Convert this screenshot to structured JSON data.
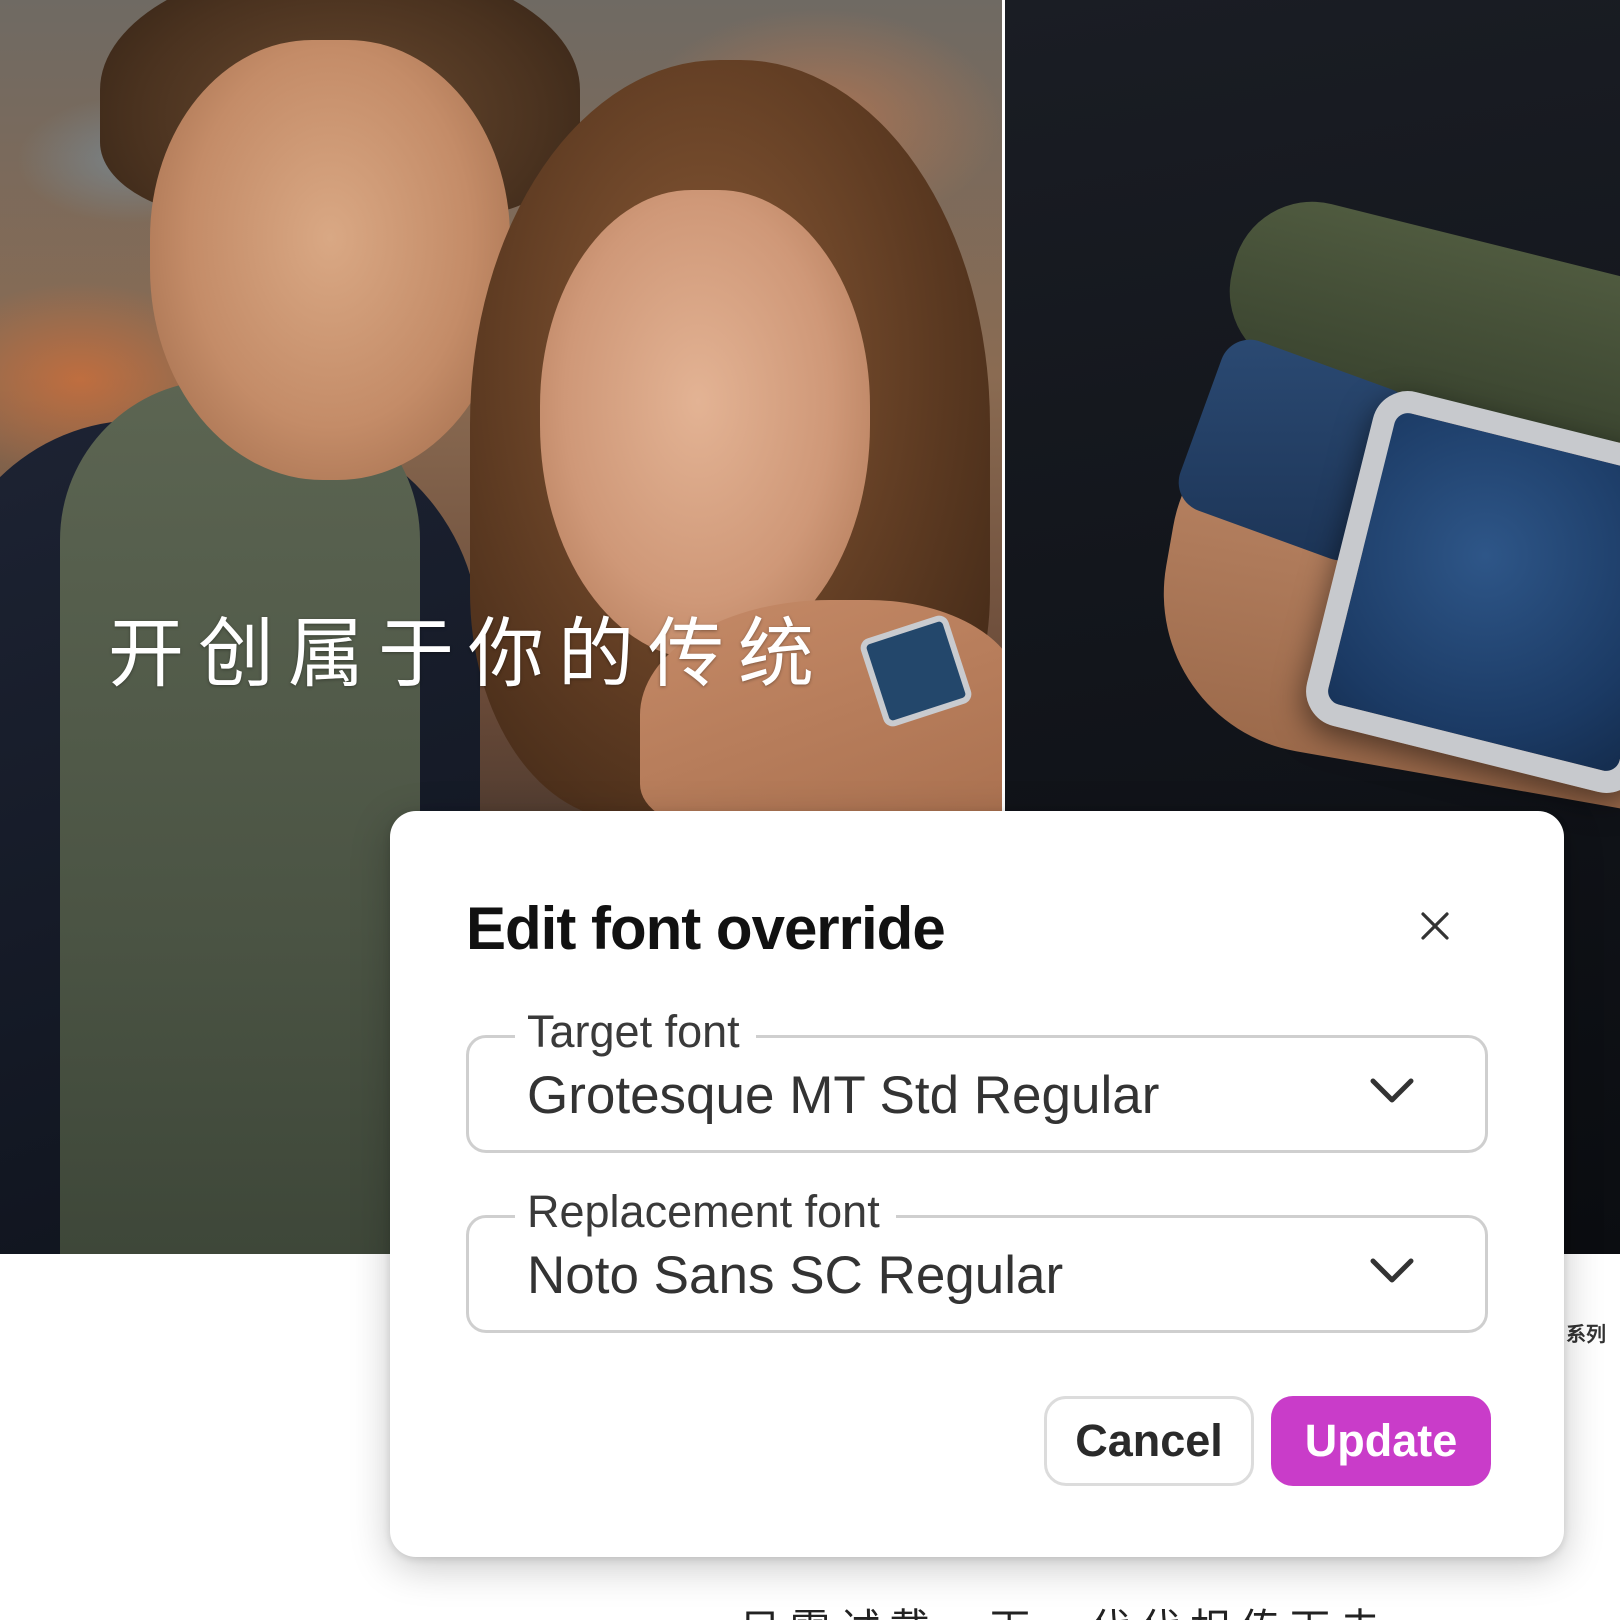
{
  "background": {
    "headline": "开创属于你的传统",
    "side_caption": "系列",
    "bottom_caption": "只需试戴一下，代代相传下去"
  },
  "dialog": {
    "title": "Edit font override",
    "close_icon": "close-icon",
    "target_font": {
      "label": "Target font",
      "value": "Grotesque MT Std Regular",
      "icon": "chevron-down-icon"
    },
    "replacement_font": {
      "label": "Replacement font",
      "value": "Noto Sans SC Regular",
      "icon": "chevron-down-icon"
    },
    "cancel_label": "Cancel",
    "update_label": "Update"
  },
  "colors": {
    "accent": "#c93cc9",
    "field_border": "#cfcfcf",
    "title_text": "#111111"
  }
}
